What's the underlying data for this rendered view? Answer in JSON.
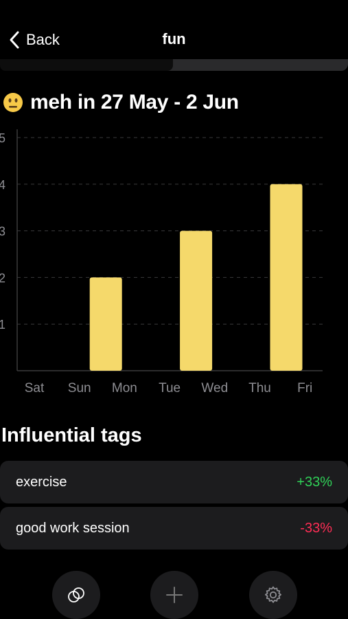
{
  "nav": {
    "back_label": "Back",
    "title": "fun"
  },
  "summary": {
    "emoji": "😐",
    "title": "meh in 27 May - 2 Jun"
  },
  "chart_data": {
    "type": "bar",
    "categories": [
      "Sat",
      "Sun",
      "Mon",
      "Tue",
      "Wed",
      "Thu",
      "Fri"
    ],
    "values": [
      0,
      2,
      0,
      3,
      0,
      4,
      0
    ],
    "yticks": [
      1,
      2,
      3,
      4,
      5
    ],
    "ylim": [
      0,
      5
    ],
    "grid": true,
    "bar_color": "#f5d96b"
  },
  "tags": {
    "title": "Influential tags",
    "items": [
      {
        "name": "exercise",
        "value": "+33%",
        "color": "#30d158"
      },
      {
        "name": "good work session",
        "value": "-33%",
        "color": "#ff2d55"
      }
    ]
  },
  "toolbar": {
    "buttons": [
      "rings-icon",
      "plus-icon",
      "gear-icon"
    ]
  }
}
